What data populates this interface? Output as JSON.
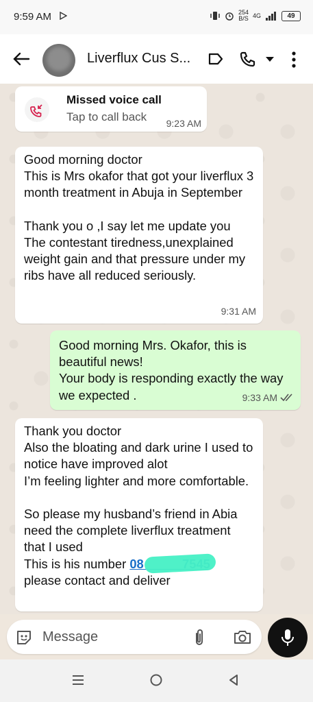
{
  "status": {
    "time": "9:59 AM",
    "speed_top": "254",
    "speed_bottom": "B/S",
    "network": "4G",
    "battery": "49"
  },
  "header": {
    "title": "Liverflux Cus S..."
  },
  "missed_call": {
    "title": "Missed voice call",
    "subtitle": "Tap to call back",
    "time": "9:23 AM"
  },
  "messages": [
    {
      "direction": "in",
      "text": "Good morning doctor\nThis is Mrs okafor that got your liverflux 3 month treatment in Abuja in September\n\nThank you o ,I say let me update you\nThe contestant tiredness,unexplained weight gain and that pressure under my ribs have all reduced seriously.",
      "time": "9:31 AM"
    },
    {
      "direction": "out",
      "text": "Good morning Mrs. Okafor, this is beautiful news!\nYour body is responding exactly the way we expected .",
      "time": "9:33 AM"
    },
    {
      "direction": "in",
      "text_before": "Thank you doctor\nAlso the bloating and dark urine I used to notice have improved alot\nI’m feeling lighter and more comfortable.\n\nSo please my husband’s friend in Abia need the complete liverflux treatment that I used\nThis is his number ",
      "number": "08           7545",
      "text_after": "\nplease contact and deliver"
    }
  ],
  "input": {
    "placeholder": "Message"
  },
  "colors": {
    "incoming": "#ffffff",
    "outgoing": "#d9fdd3",
    "chat_bg": "#ece5dd",
    "link": "#1a6fc8",
    "missed_icon": "#d6214e"
  }
}
